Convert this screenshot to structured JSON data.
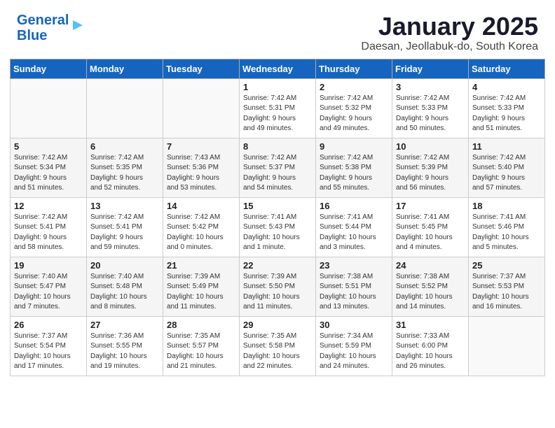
{
  "logo": {
    "line1": "General",
    "line2": "Blue"
  },
  "title": "January 2025",
  "subtitle": "Daesan, Jeollabuk-do, South Korea",
  "weekdays": [
    "Sunday",
    "Monday",
    "Tuesday",
    "Wednesday",
    "Thursday",
    "Friday",
    "Saturday"
  ],
  "weeks": [
    [
      {
        "day": "",
        "info": ""
      },
      {
        "day": "",
        "info": ""
      },
      {
        "day": "",
        "info": ""
      },
      {
        "day": "1",
        "info": "Sunrise: 7:42 AM\nSunset: 5:31 PM\nDaylight: 9 hours\nand 49 minutes."
      },
      {
        "day": "2",
        "info": "Sunrise: 7:42 AM\nSunset: 5:32 PM\nDaylight: 9 hours\nand 49 minutes."
      },
      {
        "day": "3",
        "info": "Sunrise: 7:42 AM\nSunset: 5:33 PM\nDaylight: 9 hours\nand 50 minutes."
      },
      {
        "day": "4",
        "info": "Sunrise: 7:42 AM\nSunset: 5:33 PM\nDaylight: 9 hours\nand 51 minutes."
      }
    ],
    [
      {
        "day": "5",
        "info": "Sunrise: 7:42 AM\nSunset: 5:34 PM\nDaylight: 9 hours\nand 51 minutes."
      },
      {
        "day": "6",
        "info": "Sunrise: 7:42 AM\nSunset: 5:35 PM\nDaylight: 9 hours\nand 52 minutes."
      },
      {
        "day": "7",
        "info": "Sunrise: 7:43 AM\nSunset: 5:36 PM\nDaylight: 9 hours\nand 53 minutes."
      },
      {
        "day": "8",
        "info": "Sunrise: 7:42 AM\nSunset: 5:37 PM\nDaylight: 9 hours\nand 54 minutes."
      },
      {
        "day": "9",
        "info": "Sunrise: 7:42 AM\nSunset: 5:38 PM\nDaylight: 9 hours\nand 55 minutes."
      },
      {
        "day": "10",
        "info": "Sunrise: 7:42 AM\nSunset: 5:39 PM\nDaylight: 9 hours\nand 56 minutes."
      },
      {
        "day": "11",
        "info": "Sunrise: 7:42 AM\nSunset: 5:40 PM\nDaylight: 9 hours\nand 57 minutes."
      }
    ],
    [
      {
        "day": "12",
        "info": "Sunrise: 7:42 AM\nSunset: 5:41 PM\nDaylight: 9 hours\nand 58 minutes."
      },
      {
        "day": "13",
        "info": "Sunrise: 7:42 AM\nSunset: 5:41 PM\nDaylight: 9 hours\nand 59 minutes."
      },
      {
        "day": "14",
        "info": "Sunrise: 7:42 AM\nSunset: 5:42 PM\nDaylight: 10 hours\nand 0 minutes."
      },
      {
        "day": "15",
        "info": "Sunrise: 7:41 AM\nSunset: 5:43 PM\nDaylight: 10 hours\nand 1 minute."
      },
      {
        "day": "16",
        "info": "Sunrise: 7:41 AM\nSunset: 5:44 PM\nDaylight: 10 hours\nand 3 minutes."
      },
      {
        "day": "17",
        "info": "Sunrise: 7:41 AM\nSunset: 5:45 PM\nDaylight: 10 hours\nand 4 minutes."
      },
      {
        "day": "18",
        "info": "Sunrise: 7:41 AM\nSunset: 5:46 PM\nDaylight: 10 hours\nand 5 minutes."
      }
    ],
    [
      {
        "day": "19",
        "info": "Sunrise: 7:40 AM\nSunset: 5:47 PM\nDaylight: 10 hours\nand 7 minutes."
      },
      {
        "day": "20",
        "info": "Sunrise: 7:40 AM\nSunset: 5:48 PM\nDaylight: 10 hours\nand 8 minutes."
      },
      {
        "day": "21",
        "info": "Sunrise: 7:39 AM\nSunset: 5:49 PM\nDaylight: 10 hours\nand 11 minutes."
      },
      {
        "day": "22",
        "info": "Sunrise: 7:39 AM\nSunset: 5:50 PM\nDaylight: 10 hours\nand 11 minutes."
      },
      {
        "day": "23",
        "info": "Sunrise: 7:38 AM\nSunset: 5:51 PM\nDaylight: 10 hours\nand 13 minutes."
      },
      {
        "day": "24",
        "info": "Sunrise: 7:38 AM\nSunset: 5:52 PM\nDaylight: 10 hours\nand 14 minutes."
      },
      {
        "day": "25",
        "info": "Sunrise: 7:37 AM\nSunset: 5:53 PM\nDaylight: 10 hours\nand 16 minutes."
      }
    ],
    [
      {
        "day": "26",
        "info": "Sunrise: 7:37 AM\nSunset: 5:54 PM\nDaylight: 10 hours\nand 17 minutes."
      },
      {
        "day": "27",
        "info": "Sunrise: 7:36 AM\nSunset: 5:55 PM\nDaylight: 10 hours\nand 19 minutes."
      },
      {
        "day": "28",
        "info": "Sunrise: 7:35 AM\nSunset: 5:57 PM\nDaylight: 10 hours\nand 21 minutes."
      },
      {
        "day": "29",
        "info": "Sunrise: 7:35 AM\nSunset: 5:58 PM\nDaylight: 10 hours\nand 22 minutes."
      },
      {
        "day": "30",
        "info": "Sunrise: 7:34 AM\nSunset: 5:59 PM\nDaylight: 10 hours\nand 24 minutes."
      },
      {
        "day": "31",
        "info": "Sunrise: 7:33 AM\nSunset: 6:00 PM\nDaylight: 10 hours\nand 26 minutes."
      },
      {
        "day": "",
        "info": ""
      }
    ]
  ]
}
